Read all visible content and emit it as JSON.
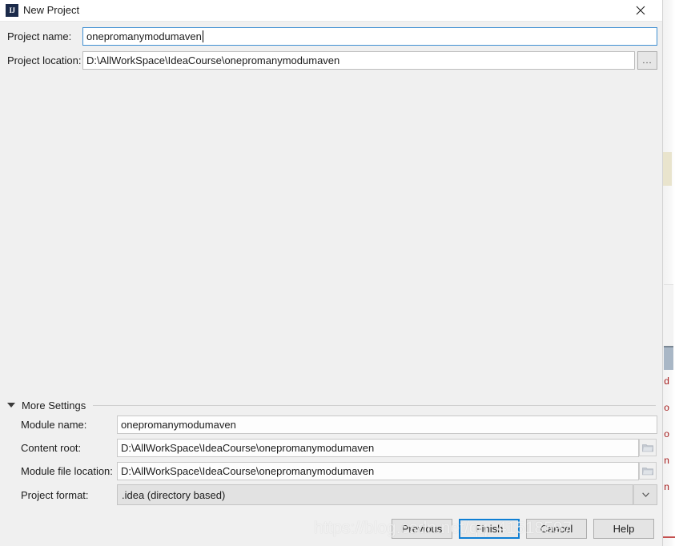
{
  "window": {
    "title": "New Project",
    "app_icon": "intellij-idea-icon",
    "icon_text": "IJ",
    "close_icon": "close-icon"
  },
  "top_fields": [
    {
      "label": "Project name:",
      "value": "onepromanymodumaven",
      "placeholder": "",
      "focused": true,
      "has_browse": false
    },
    {
      "label": "Project location:",
      "value": "D:\\AllWorkSpace\\IdeaCourse\\onepromanymodumaven",
      "placeholder": "",
      "focused": false,
      "has_browse": true,
      "browse_label": "..."
    }
  ],
  "more_settings": {
    "label": "More Settings",
    "expanded": true,
    "toggle_icon": "triangle-down-icon",
    "rows": [
      {
        "label": "Module name:",
        "value": "onepromanymodumaven",
        "type": "text",
        "browse_icon": null
      },
      {
        "label": "Content root:",
        "value": "D:\\AllWorkSpace\\IdeaCourse\\onepromanymodumaven",
        "type": "text",
        "browse_icon": "folder-icon"
      },
      {
        "label": "Module file location:",
        "value": "D:\\AllWorkSpace\\IdeaCourse\\onepromanymodumaven",
        "type": "text",
        "browse_icon": "folder-icon"
      },
      {
        "label": "Project format:",
        "value": ".idea (directory based)",
        "type": "combo",
        "browse_icon": "chevron-down-icon"
      }
    ]
  },
  "buttons": [
    {
      "label": "Previous",
      "focused": false
    },
    {
      "label": "Finish",
      "focused": true
    },
    {
      "label": "Cancel",
      "focused": false
    },
    {
      "label": "Help",
      "focused": false
    }
  ],
  "watermark": {
    "text": "https://blog.csdn.net/qq_41518597"
  },
  "background_editor": {
    "code_fragments": [
      "d",
      "o",
      "o",
      "n",
      "n"
    ],
    "scrollbar": "vertical-scrollbar"
  },
  "colors": {
    "dialog_bg": "#f0f0f0",
    "titlebar_bg": "#ffffff",
    "focus_blue": "#0f7fd4",
    "field_border": "#bdbdbd",
    "text": "#1c1c1c",
    "app_icon_bg": "#1b2a4a",
    "bg_window_border": "#c4504f",
    "bg_code_text": "#a31515",
    "bg_highlight": "#e9e4cd"
  }
}
